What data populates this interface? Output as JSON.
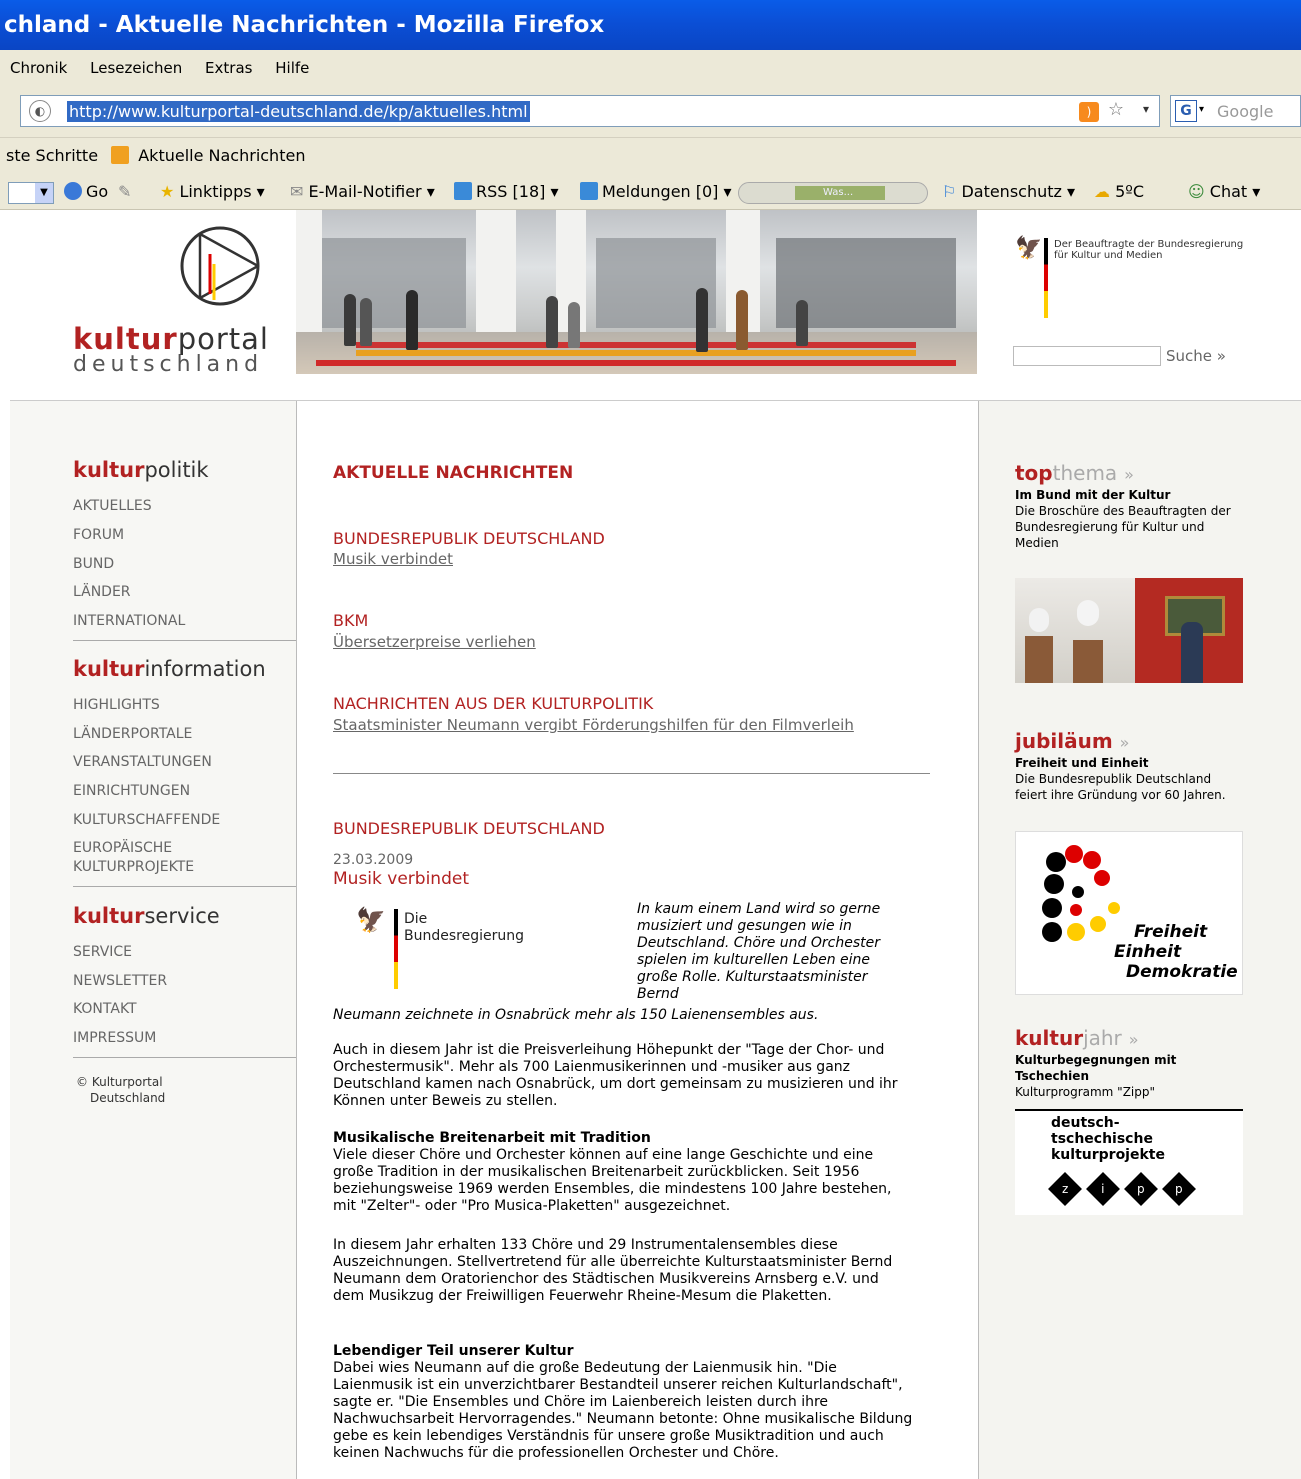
{
  "browser": {
    "title": "chland - Aktuelle Nachrichten - Mozilla Firefox",
    "menu": [
      "Chronik",
      "Lesezeichen",
      "Extras",
      "Hilfe"
    ],
    "url": "http://www.kulturportal-deutschland.de/kp/aktuelles.html",
    "search_placeholder": "Google",
    "search_engine_icon": "G",
    "bookmarks": [
      "ste Schritte",
      "Aktuelle Nachrichten"
    ],
    "toolbar": {
      "go": "Go",
      "linktipps": "Linktipps",
      "email": "E-Mail-Notifier",
      "rss": "RSS [18]",
      "meldungen": "Meldungen [0]",
      "player_text": "Was...",
      "datenschutz": "Datenschutz",
      "weather": "5ºC",
      "chat": "Chat"
    }
  },
  "site": {
    "logo_bold": "kultur",
    "logo_rest": "portal",
    "logo_sub": "deutschland",
    "bkm_text": "Der Beauftragte der Bundesregierung für Kultur und Medien",
    "search_button": "Suche »"
  },
  "left_nav": {
    "sections": [
      {
        "bold": "kultur",
        "rest": "politik",
        "items": [
          "AKTUELLES",
          "FORUM",
          "BUND",
          "LÄNDER",
          "INTERNATIONAL"
        ]
      },
      {
        "bold": "kultur",
        "rest": "information",
        "items": [
          "HIGHLIGHTS",
          "LÄNDERPORTALE",
          "VERANSTALTUNGEN",
          "EINRICHTUNGEN",
          "KULTURSCHAFFENDE",
          "EUROPÄISCHE",
          "KULTURPROJEKTE"
        ]
      },
      {
        "bold": "kultur",
        "rest": "service",
        "items": [
          "SERVICE",
          "NEWSLETTER",
          "KONTAKT",
          "IMPRESSUM"
        ]
      }
    ],
    "copyright_1": "© Kulturportal",
    "copyright_2": "Deutschland"
  },
  "main": {
    "title": "AKTUELLE NACHRICHTEN",
    "news": [
      {
        "category": "BUNDESREPUBLIK DEUTSCHLAND",
        "link": "Musik verbindet"
      },
      {
        "category": "BKM",
        "link": "Übersetzerpreise verliehen"
      },
      {
        "category": "NACHRICHTEN AUS DER KULTURPOLITIK",
        "link": "Staatsminister Neumann vergibt Förderungshilfen für den Filmverleih"
      }
    ],
    "article": {
      "category": "BUNDESREPUBLIK DEUTSCHLAND",
      "date": "23.03.2009",
      "headline": "Musik verbindet",
      "logo_line1": "Die",
      "logo_line2": "Bundesregierung",
      "teaser": "In kaum einem Land wird so gerne musiziert und gesungen wie in Deutschland. Chöre und Orchester spielen im kulturellen Leben eine große Rolle. Kulturstaatsminister Bernd",
      "teaser_end": "Neumann zeichnete in Osnabrück mehr als 150 Laienensembles aus.",
      "p1": "Auch in diesem Jahr ist die Preisverleihung Höhepunkt der \"Tage der Chor- und Orchestermusik\". Mehr als 700 Laienmusikerinnen und -musiker aus ganz Deutschland kamen nach Osnabrück, um dort gemeinsam zu musizieren und ihr Können unter Beweis zu stellen.",
      "h2": "Musikalische Breitenarbeit mit Tradition",
      "p2": "Viele dieser Chöre und Orchester können auf eine lange Geschichte und eine große Tradition in der musikalischen Breitenarbeit zurückblicken. Seit 1956 beziehungsweise 1969 werden Ensembles, die mindestens 100 Jahre bestehen, mit \"Zelter\"- oder \"Pro Musica-Plaketten\" ausgezeichnet.",
      "p3": "In diesem Jahr erhalten 133 Chöre und 29 Instrumentalensembles diese Auszeichnungen. Stellvertretend für alle überreichte Kulturstaatsminister Bernd Neumann dem Oratorienchor des Städtischen Musikvereins Arnsberg e.V. und dem Musikzug der Freiwilligen Feuerwehr Rheine-Mesum die Plaketten.",
      "h3": "Lebendiger Teil unserer Kultur",
      "p4": "Dabei wies Neumann auf die große Bedeutung der Laienmusik hin. \"Die Laienmusik ist ein unverzichtbarer Bestandteil unserer reichen Kulturlandschaft\", sagte er. \"Die Ensembles und Chöre im Laienbereich leisten durch ihre Nachwuchsarbeit Hervorragendes.\" Neumann betonte: Ohne musikalische Bildung gebe es kein lebendiges Verständnis für unsere große Musiktradition und auch keinen Nachwuchs für die professionellen Orchester und Chöre."
    }
  },
  "right": {
    "topthema": {
      "bold": "top",
      "rest": "thema",
      "arrow": "»",
      "sub": "Im Bund mit der Kultur",
      "text": "Die Broschüre des Beauftragten der Bundesregierung für Kultur und Medien"
    },
    "jubilaeum": {
      "bold": "jubiläum",
      "arrow": "»",
      "sub": "Freiheit und Einheit",
      "text": "Die Bundesrepublik Deutschland feiert ihre Gründung vor 60 Jahren.",
      "img_l1": "Freiheit",
      "img_l2": "Einheit",
      "img_l3": "Demokratie"
    },
    "kulturjahr": {
      "bold": "kultur",
      "rest": "jahr",
      "arrow": "»",
      "sub": "Kulturbegegnungen mit Tschechien",
      "text": "Kulturprogramm \"Zipp\"",
      "img_l1": "deutsch-",
      "img_l2": "tschechische",
      "img_l3": "kulturprojekte",
      "zipp": [
        "z",
        "i",
        "p",
        "p"
      ]
    }
  }
}
